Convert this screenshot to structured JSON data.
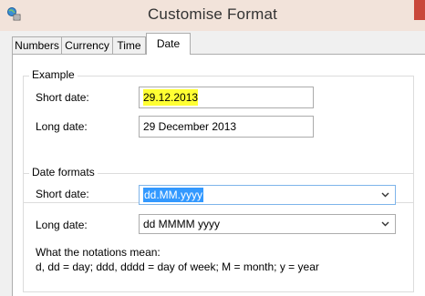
{
  "window": {
    "title": "Customise Format"
  },
  "tabs": [
    {
      "label": "Numbers",
      "active": false
    },
    {
      "label": "Currency",
      "active": false
    },
    {
      "label": "Time",
      "active": false
    },
    {
      "label": "Date",
      "active": true
    }
  ],
  "example": {
    "group_label": "Example",
    "short_date_label": "Short date:",
    "short_date_value": "29.12.2013",
    "long_date_label": "Long date:",
    "long_date_value": "29 December 2013"
  },
  "date_formats": {
    "group_label": "Date formats",
    "short_date_label": "Short date:",
    "short_date_value": "dd.MM.yyyy",
    "long_date_label": "Long date:",
    "long_date_value": "dd MMMM yyyy",
    "notation_title": "What the notations mean:",
    "notation_text": "d, dd = day;  ddd, dddd = day of week;  M = month;  y = year"
  },
  "colors": {
    "highlight": "#ffff33",
    "selection": "#3399ff",
    "titlebar": "#f2e3da",
    "close": "#c9483b"
  },
  "icons": {
    "app_icon": "regional-settings-icon",
    "dropdown": "chevron-down-icon"
  }
}
